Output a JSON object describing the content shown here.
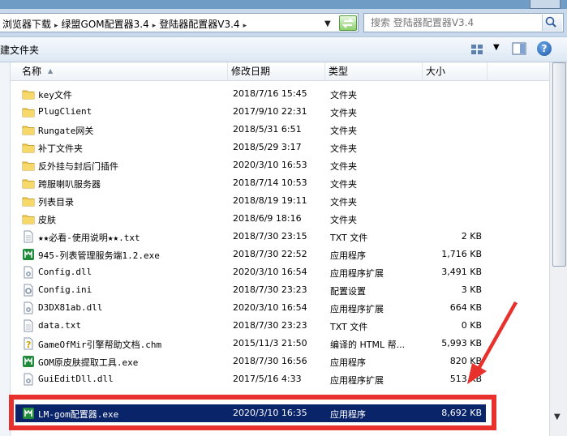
{
  "breadcrumb": [
    "浏览器下载",
    "绿盟GOM配置器3.4",
    "登陆器配置器V3.4"
  ],
  "search": {
    "placeholder": "搜索 登陆器配置器V3.4"
  },
  "toolbar": {
    "new_folder": "建文件夹"
  },
  "columns": {
    "name": "名称",
    "date": "修改日期",
    "type": "类型",
    "size": "大小"
  },
  "files": [
    {
      "name": "key文件",
      "date": "2018/7/16 15:45",
      "type": "文件夹",
      "size": "",
      "icon": "folder-icon"
    },
    {
      "name": "PlugClient",
      "date": "2017/9/10 22:31",
      "type": "文件夹",
      "size": "",
      "icon": "folder-icon"
    },
    {
      "name": "Rungate网关",
      "date": "2018/5/31 6:51",
      "type": "文件夹",
      "size": "",
      "icon": "folder-icon"
    },
    {
      "name": "补丁文件夹",
      "date": "2018/5/29 3:17",
      "type": "文件夹",
      "size": "",
      "icon": "folder-icon"
    },
    {
      "name": "反外挂与封后门插件",
      "date": "2020/3/10 16:53",
      "type": "文件夹",
      "size": "",
      "icon": "folder-icon"
    },
    {
      "name": "跨服喇叭服务器",
      "date": "2018/7/14 10:53",
      "type": "文件夹",
      "size": "",
      "icon": "folder-icon"
    },
    {
      "name": "列表目录",
      "date": "2018/8/19 19:11",
      "type": "文件夹",
      "size": "",
      "icon": "folder-icon"
    },
    {
      "name": "皮肤",
      "date": "2018/6/9 18:16",
      "type": "文件夹",
      "size": "",
      "icon": "folder-icon"
    },
    {
      "name": "★★必看-使用说明★★.txt",
      "date": "2018/7/30 23:15",
      "type": "TXT 文件",
      "size": "2 KB",
      "icon": "text-file-icon"
    },
    {
      "name": "945-列表管理服务端1.2.exe",
      "date": "2018/7/30 22:52",
      "type": "应用程序",
      "size": "1,716 KB",
      "icon": "app-icon"
    },
    {
      "name": "Config.dll",
      "date": "2020/3/10 16:54",
      "type": "应用程序扩展",
      "size": "3,491 KB",
      "icon": "dll-icon"
    },
    {
      "name": "Config.ini",
      "date": "2018/7/30 23:23",
      "type": "配置设置",
      "size": "3 KB",
      "icon": "ini-icon"
    },
    {
      "name": "D3DX81ab.dll",
      "date": "2020/3/10 16:54",
      "type": "应用程序扩展",
      "size": "664 KB",
      "icon": "dll-icon"
    },
    {
      "name": "data.txt",
      "date": "2018/7/30 23:23",
      "type": "TXT 文件",
      "size": "0 KB",
      "icon": "text-file-icon"
    },
    {
      "name": "GameOfMir引擎帮助文档.chm",
      "date": "2015/11/3 21:50",
      "type": "编译的 HTML 帮...",
      "size": "5,993 KB",
      "icon": "chm-icon"
    },
    {
      "name": "GOM原皮肤提取工具.exe",
      "date": "2018/7/30 16:56",
      "type": "应用程序",
      "size": "820 KB",
      "icon": "app-icon"
    },
    {
      "name": "GuiEditDll.dll",
      "date": "2017/5/16 4:33",
      "type": "应用程序扩展",
      "size": "513 KB",
      "icon": "dll-icon"
    }
  ],
  "selected_file": {
    "name": "LM-gom配置器.exe",
    "date": "2020/3/10 16:35",
    "type": "应用程序",
    "size": "8,692 KB",
    "icon": "app-icon"
  },
  "colors": {
    "highlight": "#e8312c",
    "selection": "#0a246a",
    "app_icon": "#1f8a3a"
  }
}
